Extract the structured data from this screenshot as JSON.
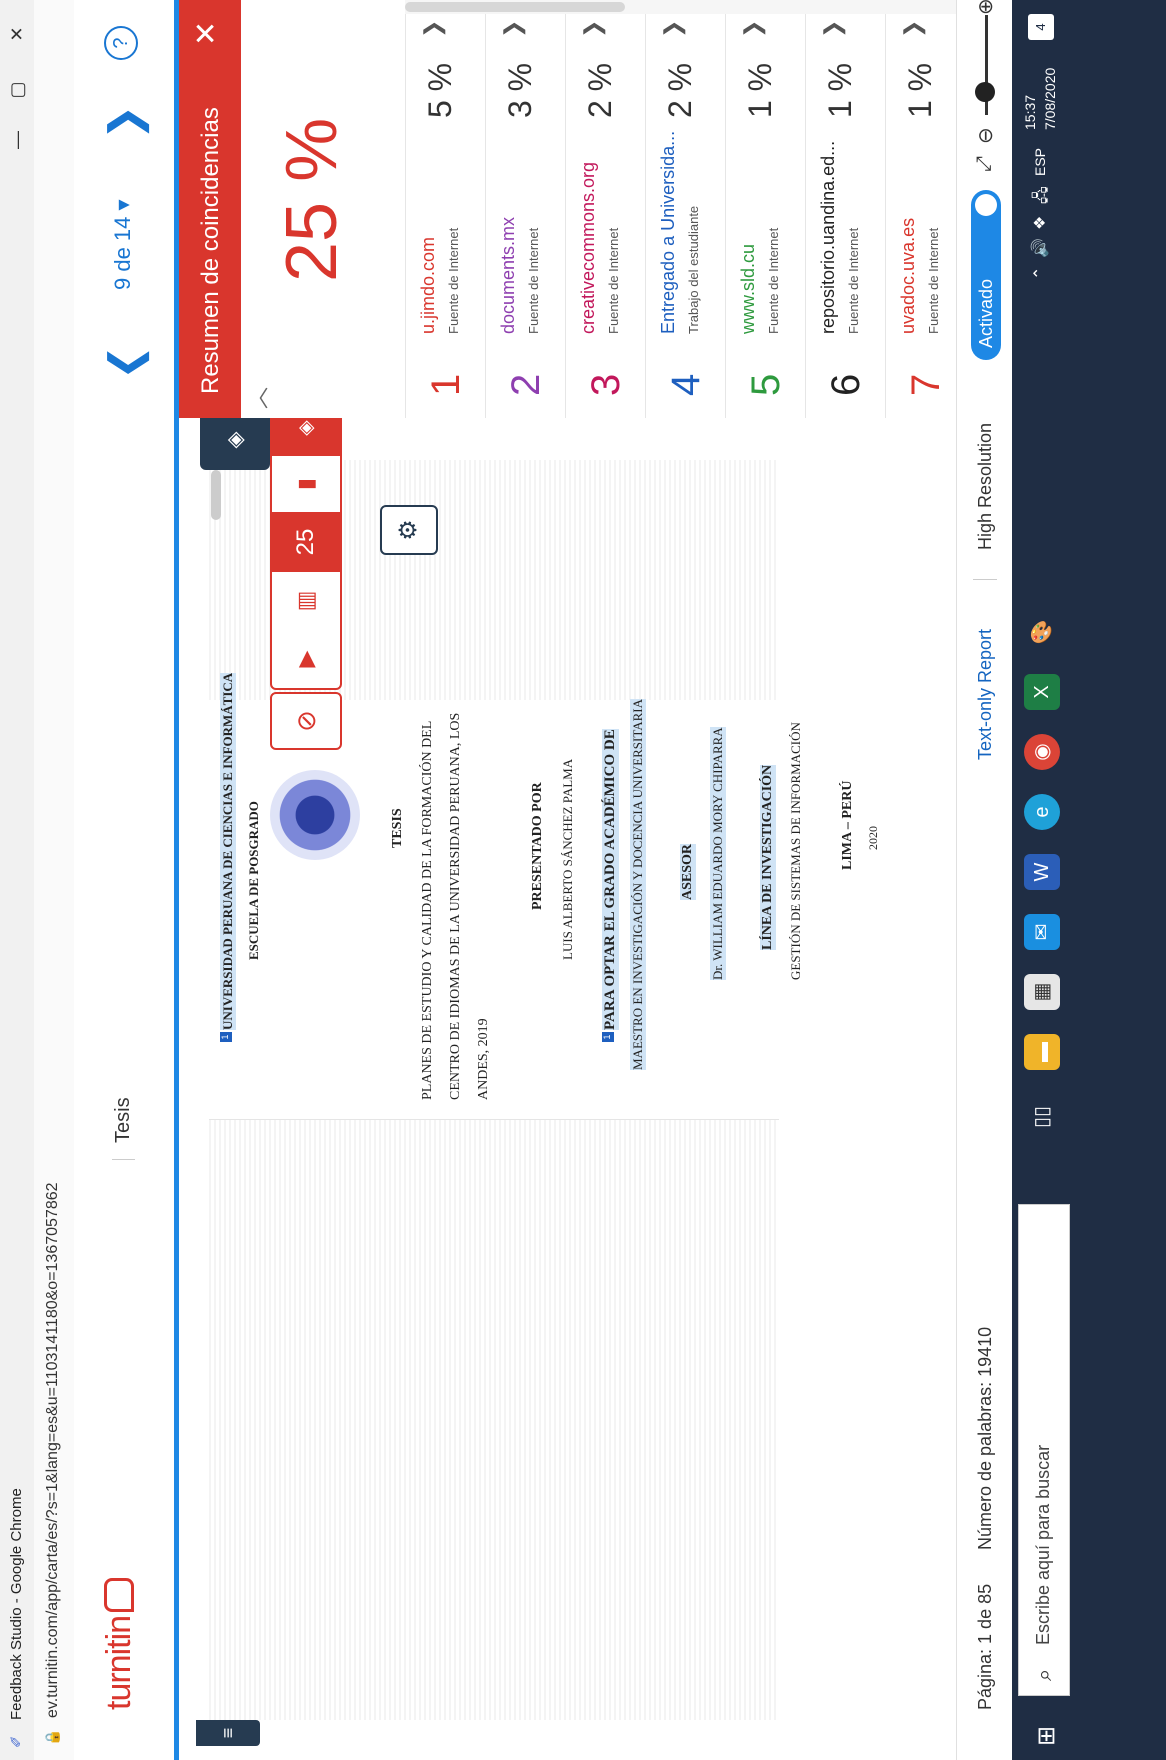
{
  "window": {
    "title": "Feedback Studio - Google Chrome",
    "url": "ev.turnitin.com/app/carta/es/?s=1&lang=es&u=1103141180&o=1367057862",
    "controls": [
      "—",
      "▢",
      "✕"
    ]
  },
  "header": {
    "logo_text": "turnitin",
    "doc_title": "Tesis",
    "pager_text": "9 de 14 ▾",
    "help": "?"
  },
  "document": {
    "university": "UNIVERSIDAD PERUANA DE CIENCIAS E INFORMÁTICA",
    "school": "ESCUELA DE POSGRADO",
    "type": "TESIS",
    "title_line1": "PLANES DE ESTUDIO Y CALIDAD DE LA FORMACIÓN DEL",
    "title_line2": "CENTRO DE IDIOMAS DE LA UNIVERSIDAD PERUANA, LOS",
    "title_line3": "ANDES, 2019",
    "presented_label": "PRESENTADO POR",
    "author": "LUIS ALBERTO SÁNCHEZ PALMA",
    "degree_label": "PARA OPTAR EL GRADO ACADÉMICO DE",
    "degree": "MAESTRO EN INVESTIGACIÓN Y DOCENCIA UNIVERSITARIA",
    "advisor_label": "ASESOR",
    "advisor": "Dr. WILLIAM EDUARDO MORY CHIPARRA",
    "line_label": "LÍNEA DE INVESTIGACIÓN",
    "line": "GESTIÓN DE SISTEMAS DE INFORMACIÓN",
    "city": "LIMA – PERÚ",
    "year": "2020",
    "match_marks": [
      "1",
      "1"
    ]
  },
  "rail": {
    "score_badge": "25"
  },
  "panel": {
    "title": "Resumen de coincidencias",
    "score": "25 %",
    "matches": [
      {
        "num": "1",
        "source": "u.jimdo.com",
        "type": "Fuente de Internet",
        "pct": "5 %",
        "color": "#d9362d"
      },
      {
        "num": "2",
        "source": "documents.mx",
        "type": "Fuente de Internet",
        "pct": "3 %",
        "color": "#8e3fb0"
      },
      {
        "num": "3",
        "source": "creativecommons.org",
        "type": "Fuente de Internet",
        "pct": "2 %",
        "color": "#c2185b"
      },
      {
        "num": "4",
        "source": "Entregado a Universida...",
        "type": "Trabajo del estudiante",
        "pct": "2 %",
        "color": "#1e5fbf"
      },
      {
        "num": "5",
        "source": "www.sld.cu",
        "type": "Fuente de Internet",
        "pct": "1 %",
        "color": "#2e9a3e"
      },
      {
        "num": "6",
        "source": "repositorio.uandina.ed...",
        "type": "Fuente de Internet",
        "pct": "1 %",
        "color": "#222222"
      },
      {
        "num": "7",
        "source": "uvadoc.uva.es",
        "type": "Fuente de Internet",
        "pct": "1 %",
        "color": "#d9362d"
      }
    ]
  },
  "status": {
    "page": "Página: 1 de 85",
    "words": "Número de palabras: 19410",
    "text_only": "Text-only Report",
    "high_res": "High Resolution",
    "toggle": "Activado"
  },
  "taskbar": {
    "search_placeholder": "Escribe aquí para buscar",
    "lang": "ESP",
    "time": "15:37",
    "date": "7/08/2020",
    "notif": "4"
  }
}
